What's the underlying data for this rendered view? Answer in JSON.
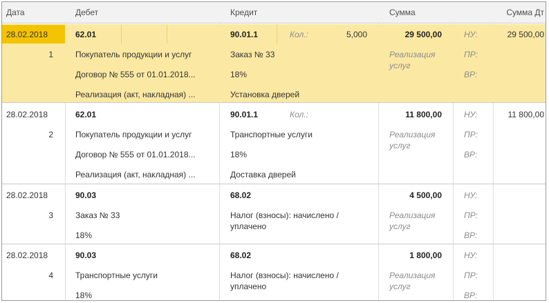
{
  "headers": {
    "date": "Дата",
    "debit": "Дебет",
    "credit": "Кредит",
    "sum": "Сумма",
    "sum_dt": "Сумма Дт"
  },
  "entries": [
    {
      "date": "28.02.2018",
      "num": "1",
      "debit_account": "62.01",
      "debit_sub1": "Покупатель продукции и услуг",
      "debit_sub2": "Договор № 555 от 01.01.2018...",
      "debit_sub3": "Реализация (акт, накладная) ...",
      "credit_account": "90.01.1",
      "qty_label": "Кол.:",
      "qty_value": "5,000",
      "credit_sub1": "Заказ № 33",
      "credit_sub2": "18%",
      "credit_sub3": "Установка дверей",
      "amount": "29 500,00",
      "content": "Реализация услуг",
      "nu_label": "НУ:",
      "pr_label": "ПР:",
      "vr_label": "ВР:",
      "sum_dt": "29 500,00"
    },
    {
      "date": "28.02.2018",
      "num": "2",
      "debit_account": "62.01",
      "debit_sub1": "Покупатель продукции и услуг",
      "debit_sub2": "Договор № 555 от 01.01.2018...",
      "debit_sub3": "Реализация (акт, накладная) ...",
      "credit_account": "90.01.1",
      "qty_label": "Кол.:",
      "credit_sub1": "Транспортные услуги",
      "credit_sub2": "18%",
      "credit_sub3": "Доставка дверей",
      "amount": "11 800,00",
      "content": "Реализация услуг",
      "nu_label": "НУ:",
      "pr_label": "ПР:",
      "vr_label": "ВР:",
      "sum_dt": "11 800,00"
    },
    {
      "date": "28.02.2018",
      "num": "3",
      "debit_account": "90.03",
      "debit_sub1": "Заказ № 33",
      "debit_sub2": "18%",
      "credit_account": "68.02",
      "credit_sub1": "Налог (взносы): начислено / уплачено",
      "amount": "4 500,00",
      "content": "Реализация услуг",
      "nu_label": "НУ:",
      "pr_label": "ПР:",
      "vr_label": "ВР:"
    },
    {
      "date": "28.02.2018",
      "num": "4",
      "debit_account": "90.03",
      "debit_sub1": "Транспортные услуги",
      "debit_sub2": "18%",
      "credit_account": "68.02",
      "credit_sub1": "Налог (взносы): начислено / уплачено",
      "amount": "1 800,00",
      "content": "Реализация услуг",
      "nu_label": "НУ:",
      "pr_label": "ПР:",
      "vr_label": "ВР:"
    }
  ]
}
